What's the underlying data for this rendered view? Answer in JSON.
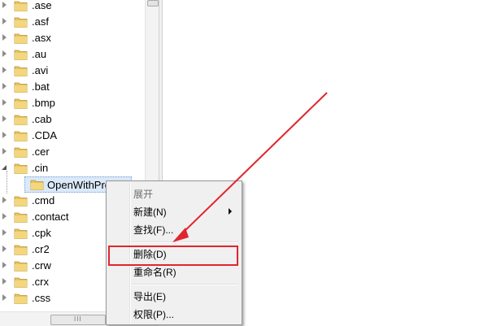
{
  "tree": {
    "items": [
      {
        "label": ".ase",
        "expanded": false
      },
      {
        "label": ".asf",
        "expanded": false
      },
      {
        "label": ".asx",
        "expanded": false
      },
      {
        "label": ".au",
        "expanded": false
      },
      {
        "label": ".avi",
        "expanded": false
      },
      {
        "label": ".bat",
        "expanded": false
      },
      {
        "label": ".bmp",
        "expanded": false
      },
      {
        "label": ".cab",
        "expanded": false
      },
      {
        "label": ".CDA",
        "expanded": false
      },
      {
        "label": ".cer",
        "expanded": false
      },
      {
        "label": ".cin",
        "expanded": true
      },
      {
        "label": ".cmd",
        "expanded": false
      },
      {
        "label": ".contact",
        "expanded": false
      },
      {
        "label": ".cpk",
        "expanded": false
      },
      {
        "label": ".cr2",
        "expanded": false
      },
      {
        "label": ".crw",
        "expanded": false
      },
      {
        "label": ".crx",
        "expanded": false
      },
      {
        "label": ".css",
        "expanded": false
      }
    ],
    "selected_child": "OpenWithProgids",
    "hscroll_grip": "III"
  },
  "menu": {
    "items": [
      {
        "label": "展开",
        "disabled": true
      },
      {
        "label": "新建(N)",
        "submenu": true
      },
      {
        "label": "查找(F)..."
      },
      {
        "label": "删除(D)",
        "highlight": true
      },
      {
        "label": "重命名(R)"
      },
      {
        "label": "导出(E)"
      },
      {
        "label": "权限(P)..."
      }
    ]
  },
  "colors": {
    "annotation": "#e0262d",
    "folder": "#e8c45a",
    "selection": "#dbe9f8"
  }
}
